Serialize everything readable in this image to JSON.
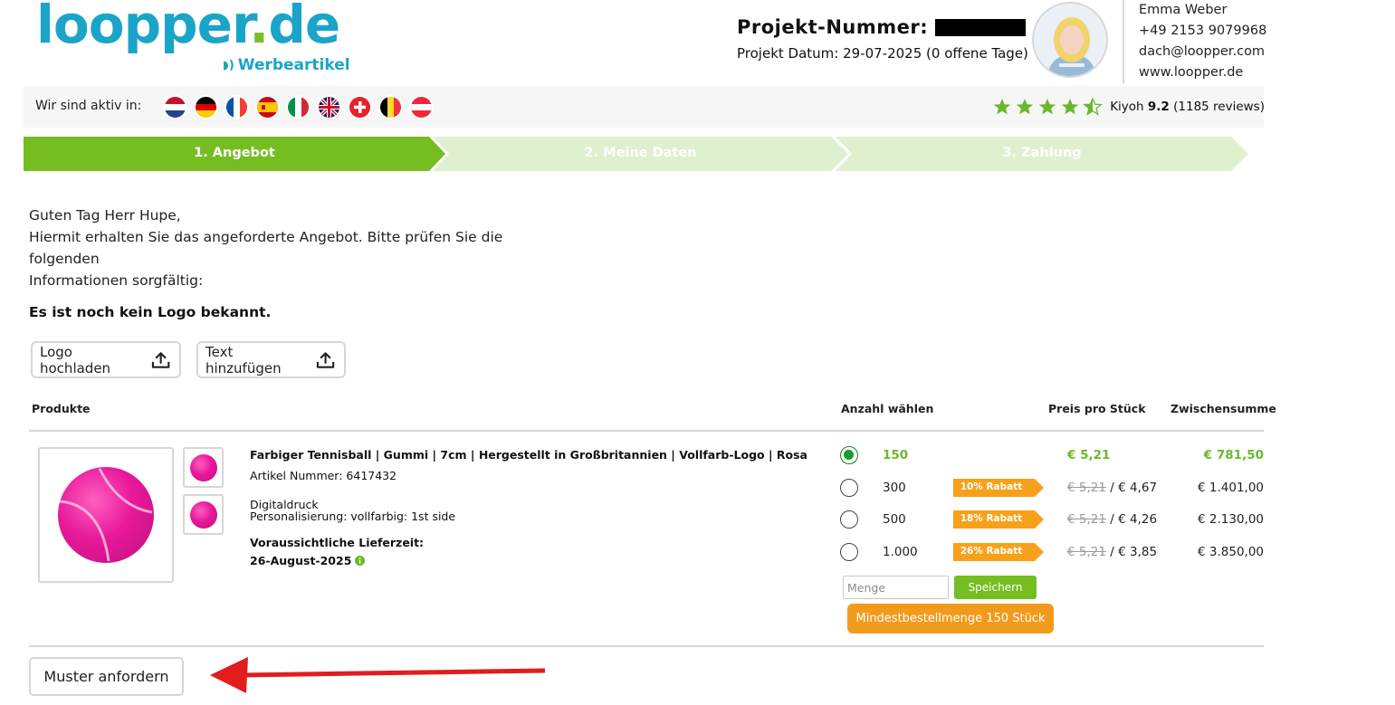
{
  "brand": {
    "logo_main": "loopper",
    "logo_dot": ".",
    "logo_tld": "de",
    "logo_sub": "Werbeartikel",
    "primary_color": "#1aa5c8",
    "accent_color": "#7cbf2a"
  },
  "project": {
    "number_label": "Projekt-Nummer:",
    "date_text": "Projekt Datum: 29-07-2025 (0 offene Tage)"
  },
  "contact": {
    "name": "Emma Weber",
    "phone": "+49 2153 9079968",
    "email": "dach@loopper.com",
    "website": "www.loopper.de",
    "avatar_icon": "person-avatar-icon"
  },
  "countries": {
    "label": "Wir sind aktiv in:",
    "flags": [
      "nl",
      "de",
      "fr",
      "es",
      "it",
      "gb",
      "ch",
      "be",
      "at"
    ]
  },
  "rating": {
    "provider": "Kiyoh",
    "score": "9.2",
    "count_text": "(1185 reviews)",
    "stars": 4.5,
    "star_color": "#6ab82a"
  },
  "steps": [
    {
      "label": "1. Angebot",
      "active": true
    },
    {
      "label": "2. Meine Daten",
      "active": false
    },
    {
      "label": "3. Zahlung",
      "active": false
    }
  ],
  "intro": {
    "greeting": "Guten Tag Herr Hupe,",
    "line1": "Hiermit erhalten Sie das angeforderte Angebot. Bitte prüfen Sie die folgenden",
    "line2": "Informationen sorgfältig:",
    "no_logo": "Es ist noch kein Logo bekannt."
  },
  "actions": {
    "upload_logo": "Logo hochladen",
    "add_text": "Text hinzufügen"
  },
  "table": {
    "headers": {
      "products": "Produkte",
      "quantity": "Anzahl wählen",
      "unit_price": "Preis pro Stück",
      "subtotal": "Zwischensumme"
    }
  },
  "product": {
    "title": "Farbiger Tennisball | Gummi | 7cm | Hergestellt in Großbritannien | Vollfarb-Logo | Rosa",
    "article": "Artikel Nummer: 6417432",
    "print_method": "Digitaldruck",
    "personalisation": "Personalisierung: vollfarbig: 1st side",
    "delivery_label": "Voraussichtliche Lieferzeit:",
    "delivery_date": "26-August-2025",
    "color": "#e8189a"
  },
  "options": [
    {
      "qty": "150",
      "selected": true,
      "badge": "",
      "old_price": "",
      "price": "€ 5,21",
      "subtotal": "€ 781,50"
    },
    {
      "qty": "300",
      "selected": false,
      "badge": "10% Rabatt",
      "old_price": "€ 5,21",
      "price": "/ € 4,67",
      "subtotal": "€ 1.401,00"
    },
    {
      "qty": "500",
      "selected": false,
      "badge": "18% Rabatt",
      "old_price": "€ 5,21",
      "price": "/ € 4,26",
      "subtotal": "€ 2.130,00"
    },
    {
      "qty": "1.000",
      "selected": false,
      "badge": "26% Rabatt",
      "old_price": "€ 5,21",
      "price": "/ € 3,85",
      "subtotal": "€ 3.850,00"
    }
  ],
  "quantity_form": {
    "placeholder": "Menge",
    "save_label": "Speichern",
    "min_order": "Mindestbestellmenge 150 Stück"
  },
  "footer": {
    "sample_button": "Muster anfordern"
  }
}
